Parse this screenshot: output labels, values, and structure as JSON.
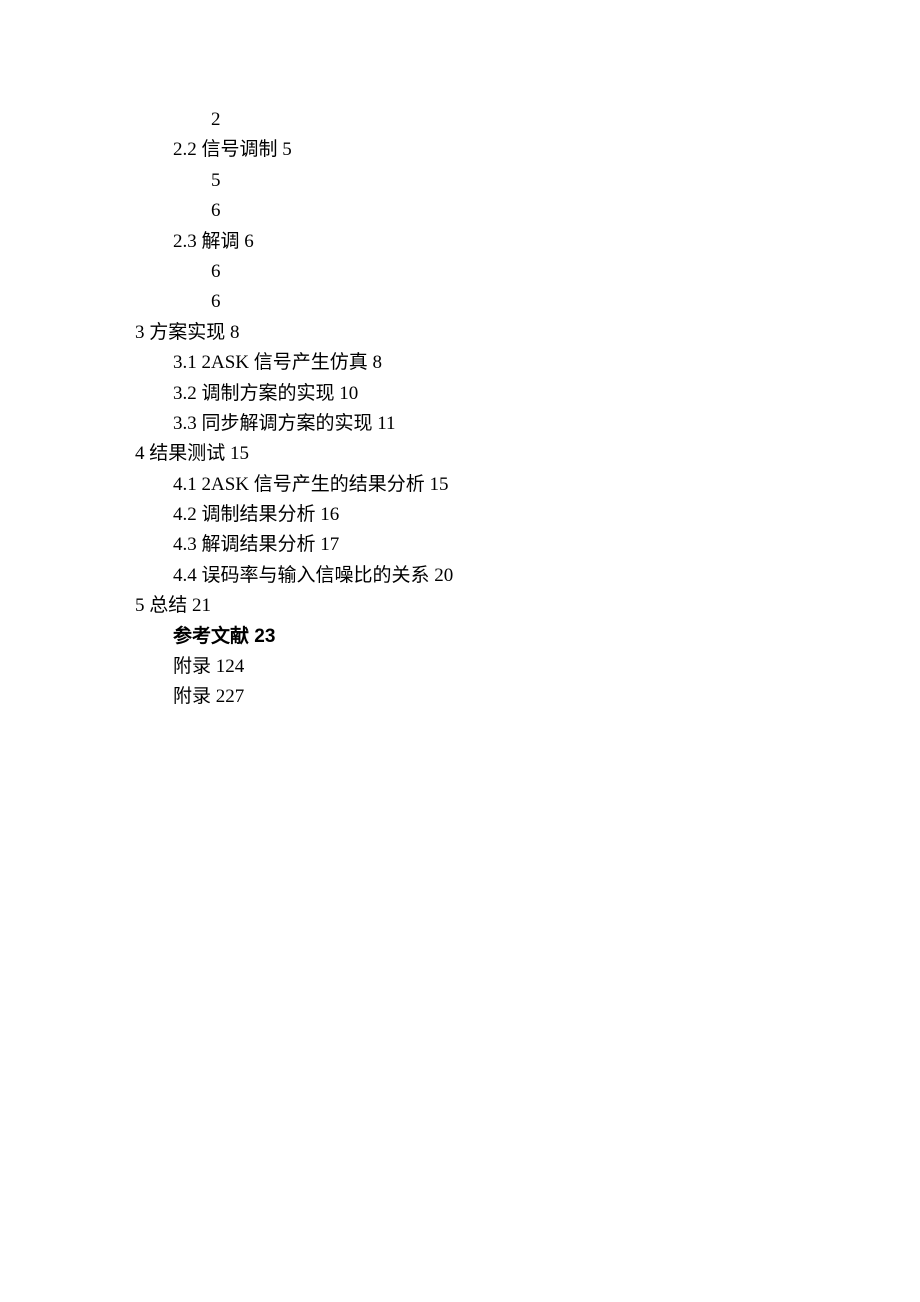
{
  "toc": {
    "lines": [
      {
        "text": "2",
        "indent": 2,
        "bold": false
      },
      {
        "text": "2.2 信号调制 5",
        "indent": 1,
        "bold": false
      },
      {
        "text": "5",
        "indent": 2,
        "bold": false
      },
      {
        "text": "6",
        "indent": 2,
        "bold": false
      },
      {
        "text": "2.3 解调 6",
        "indent": 1,
        "bold": false
      },
      {
        "text": "6",
        "indent": 2,
        "bold": false
      },
      {
        "text": "6",
        "indent": 2,
        "bold": false
      },
      {
        "text": "3 方案实现 8",
        "indent": 0,
        "bold": false
      },
      {
        "text": "3.1 2ASK 信号产生仿真 8",
        "indent": 1,
        "bold": false
      },
      {
        "text": "3.2 调制方案的实现 10",
        "indent": 1,
        "bold": false
      },
      {
        "text": "3.3 同步解调方案的实现 11",
        "indent": 1,
        "bold": false
      },
      {
        "text": "4 结果测试 15",
        "indent": 0,
        "bold": false
      },
      {
        "text": "4.1 2ASK 信号产生的结果分析 15",
        "indent": 1,
        "bold": false
      },
      {
        "text": "4.2 调制结果分析 16",
        "indent": 1,
        "bold": false
      },
      {
        "text": "4.3 解调结果分析 17",
        "indent": 1,
        "bold": false
      },
      {
        "text": "4.4 误码率与输入信噪比的关系 20",
        "indent": 1,
        "bold": false
      },
      {
        "text": "5 总结 21",
        "indent": 0,
        "bold": false
      },
      {
        "text": "参考文献 23",
        "indent": 1,
        "bold": true
      },
      {
        "text": "附录 124",
        "indent": 1,
        "bold": false
      },
      {
        "text": "附录 227",
        "indent": 1,
        "bold": false
      }
    ]
  }
}
